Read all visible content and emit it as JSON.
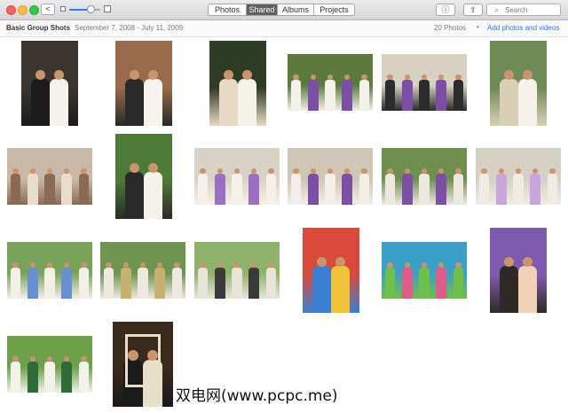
{
  "toolbar": {
    "back_glyph": "<",
    "zoom_level": 0.68,
    "tabs": [
      "Photos",
      "Shared",
      "Albums",
      "Projects"
    ],
    "active_tab": "Shared",
    "info_glyph": "ⓘ",
    "share_glyph": "⇧",
    "search_placeholder": "Search",
    "search_icon_glyph": "⌕"
  },
  "header": {
    "album_title": "Basic Group Shots",
    "date_range": "September 7, 2008 - July 11, 2009",
    "photo_count": "20 Photos",
    "separator": "•",
    "add_link": "Add photos and videos"
  },
  "photos": [
    "wedding-bride-and-bridesmaid-portrait",
    "wedding-bride-and-bridesmaid-portrait",
    "wedding-bride-and-flower-girl",
    "wedding-party-purple-dresses",
    "wedding-groomsmen-purple-vests",
    "wedding-bride-and-groom",
    "wedding-hands-with-rings",
    "wedding-bride-with-bouquet",
    "wedding-group-under-gazebo",
    "wedding-couple-with-bridesmaids",
    "wedding-full-party-gazebo",
    "wedding-family-group",
    "wedding-family-group-outdoor",
    "wedding-family-group-gazebo",
    "wedding-guests-in-park",
    "couple-at-colorful-mural",
    "couple-at-graffiti-wall",
    "bride-closeup-portrait",
    "couple-at-university-sign",
    "couple-framed-portrait"
  ],
  "watermark": "双电网(www.pcpc.me)",
  "colors": {
    "active_segment": "#5f5f5f",
    "link": "#2a78e8",
    "dress_purple": "#7b4fa6"
  }
}
